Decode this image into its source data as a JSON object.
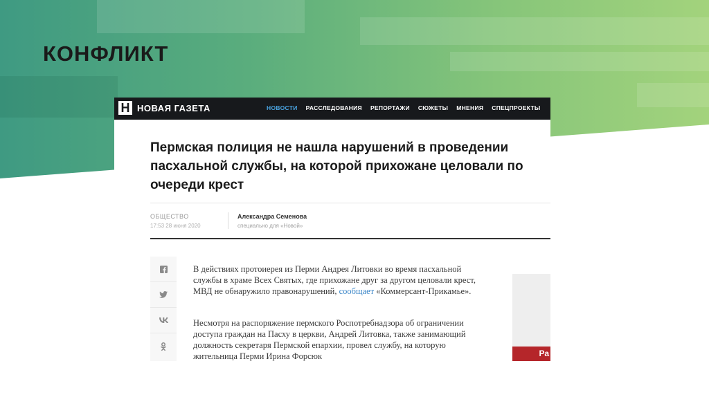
{
  "slide": {
    "title": "КОНФЛИКТ"
  },
  "site": {
    "logo_letter": "Н",
    "logo_text": "НОВАЯ ГАЗЕТА",
    "nav": [
      "НОВОСТИ",
      "РАССЛЕДОВАНИЯ",
      "РЕПОРТАЖИ",
      "СЮЖЕТЫ",
      "МНЕНИЯ",
      "СПЕЦПРОЕКТЫ"
    ]
  },
  "article": {
    "headline": "Пермская полиция не нашла нарушений в проведении пасхальной службы, на которой прихожане целовали по очереди крест",
    "category": "ОБЩЕСТВО",
    "date": "17:53 28 июня 2020",
    "author": "Александра Семенова",
    "author_role": "специально для «Новой»",
    "p1_text": "В действиях протоиерея из Перми Андрея Литовки во время пасхальной службы в храме Всех Святых, где прихожане друг за другом целовали крест, МВД не обнаружило правонарушений, ",
    "p1_link": "сообщает",
    "p1_tail": " «Коммерсант-Прикамье».",
    "p2_text": "Несмотря на распоряжение пермского Роспотребнадзора об ограничении доступа граждан на Пасху в церкви, Андрей Литовка, также занимающий должность секретаря Пермской епархии, провел службу, на которую жительница Перми Ирина Форсюк"
  },
  "share": {
    "facebook": "f",
    "twitter": "t",
    "vk": "vk",
    "ok": "ok"
  },
  "ad": {
    "label": "Ра"
  },
  "colors": {
    "nav_active": "#4aa3e0",
    "link": "#3b86c8",
    "ad": "#b5262a"
  }
}
